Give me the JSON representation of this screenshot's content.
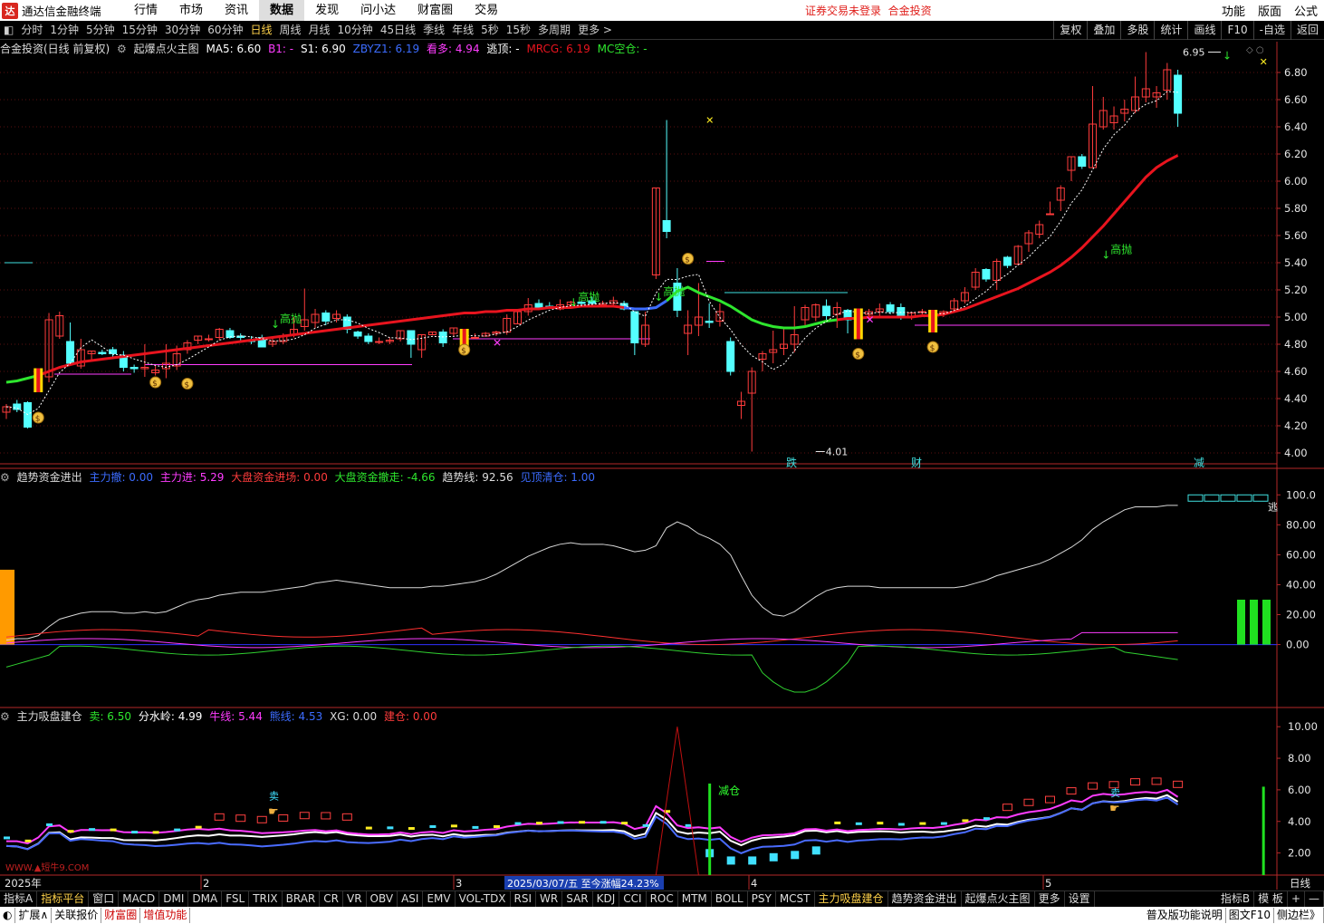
{
  "app": {
    "title": "通达信金融终端",
    "logo_char": "达",
    "login_status": "证券交易未登录",
    "stock_name": "合金投资"
  },
  "menu": [
    "行情",
    "市场",
    "资讯",
    "数据",
    "发现",
    "问小达",
    "财富圈",
    "交易"
  ],
  "right_menu": [
    "功能",
    "版面",
    "公式"
  ],
  "periods": [
    "分时",
    "1分钟",
    "5分钟",
    "15分钟",
    "30分钟",
    "60分钟",
    "日线",
    "周线",
    "月线",
    "10分钟",
    "45日线",
    "季线",
    "年线",
    "5秒",
    "15秒",
    "多周期",
    "更多 >"
  ],
  "active_period": "日线",
  "tools": [
    "复权",
    "叠加",
    "多股",
    "统计",
    "画线",
    "F10",
    "-自选",
    "返回"
  ],
  "main_panel": {
    "title": "合金投资(日线 前复权)",
    "indicator": "起爆点火主图",
    "ma5": "MA5: 6.60",
    "b1": "B1: -",
    "s1": "S1: 6.90",
    "zbyz": "ZBYZ1: 6.19",
    "kanduo": "看多: 4.94",
    "taoding": "逃顶: -",
    "mrcg": "MRCG: 6.19",
    "mckong": "MC空仓: -",
    "y_ticks": [
      "6.80",
      "6.60",
      "6.40",
      "6.20",
      "6.00",
      "5.80",
      "5.60",
      "5.40",
      "5.20",
      "5.00",
      "4.80",
      "4.60",
      "4.40",
      "4.20",
      "4.00"
    ],
    "annotations": {
      "high": "6.95",
      "low": "4.01",
      "gaopao": "高抛",
      "die": "跌",
      "cai": "财",
      "jian": "减"
    }
  },
  "mid_panel": {
    "title": "趋势资金进出",
    "zhuli_che": "主力撤: 0.00",
    "zhuli_jin": "主力进: 5.29",
    "dapan_jin": "大盘资金进场: 0.00",
    "dapan_che": "大盘资金撤走: -4.66",
    "qushi": "趋势线: 92.56",
    "jianding": "见顶清仓: 1.00",
    "y_ticks": [
      "100.0",
      "80.00",
      "60.00",
      "40.00",
      "20.00",
      "0.00"
    ],
    "tao_label": "逃"
  },
  "bot_panel": {
    "title": "主力吸盘建仓",
    "mai": "卖: 6.50",
    "fenshui": "分水岭: 4.99",
    "niuxian": "牛线: 5.44",
    "xiongxian": "熊线: 4.53",
    "xg": "XG: 0.00",
    "jiancang": "建仓: 0.00",
    "y_ticks": [
      "10.00",
      "8.00",
      "6.00",
      "4.00",
      "2.00"
    ],
    "sell_label": "卖",
    "jiancang_label": "减仓",
    "watermark": "WWW.▲短牛9.COM"
  },
  "date_axis": {
    "year": "2025年",
    "months": [
      "2",
      "3",
      "4",
      "5"
    ],
    "tooltip": "2025/03/07/五  至今涨幅24.23%",
    "period_label": "日线"
  },
  "bottom_tabs": [
    "指标A",
    "指标平台",
    "窗口",
    "MACD",
    "DMI",
    "DMA",
    "FSL",
    "TRIX",
    "BRAR",
    "CR",
    "VR",
    "OBV",
    "ASI",
    "EMV",
    "VOL-TDX",
    "RSI",
    "WR",
    "SAR",
    "KDJ",
    "CCI",
    "ROC",
    "MTM",
    "BOLL",
    "PSY",
    "MCST",
    "主力吸盘建仓",
    "趋势资金进出",
    "起爆点火主图",
    "更多",
    "设置"
  ],
  "bottom_tabs_right": [
    "指标B",
    "模 板",
    "+",
    "—"
  ],
  "footer": [
    "扩展∧",
    "关联报价",
    "财富圈",
    "增值功能"
  ],
  "footer_right": [
    "普及版功能说明",
    "图文F10",
    "侧边栏》"
  ],
  "colors": {
    "up": "#ff3c3c",
    "down": "#54ffff",
    "ma_red": "#e8141e",
    "green": "#2ee62e",
    "magenta": "#ff3cff",
    "blue": "#3c6cff",
    "axis": "#b42828"
  },
  "chart_data": {
    "type": "candlestick",
    "candles": [
      [
        4.3,
        4.34,
        4.25,
        4.36
      ],
      [
        4.36,
        4.32,
        4.3,
        4.39
      ],
      [
        4.37,
        4.19,
        4.18,
        4.38
      ],
      [
        4.58,
        4.46,
        4.46,
        4.61
      ],
      [
        4.56,
        4.98,
        4.52,
        5.03
      ],
      [
        4.86,
        5.01,
        4.84,
        5.04
      ],
      [
        4.82,
        4.66,
        4.64,
        4.96
      ],
      [
        4.64,
        4.76,
        4.62,
        4.84
      ],
      [
        4.73,
        4.75,
        4.69,
        4.75
      ],
      [
        4.74,
        4.73,
        4.72,
        4.76
      ],
      [
        4.76,
        4.73,
        4.7,
        4.78
      ],
      [
        4.72,
        4.63,
        4.6,
        4.75
      ],
      [
        4.63,
        4.62,
        4.59,
        4.65
      ],
      [
        4.62,
        4.63,
        4.56,
        4.8
      ],
      [
        4.59,
        4.61,
        4.57,
        4.64
      ],
      [
        4.62,
        4.66,
        4.55,
        4.8
      ],
      [
        4.64,
        4.73,
        4.61,
        4.79
      ],
      [
        4.76,
        4.81,
        4.73,
        4.83
      ],
      [
        4.83,
        4.86,
        4.8,
        4.86
      ],
      [
        4.84,
        4.84,
        4.82,
        4.87
      ],
      [
        4.85,
        4.91,
        4.83,
        4.92
      ],
      [
        4.9,
        4.85,
        4.84,
        4.92
      ],
      [
        4.86,
        4.85,
        4.83,
        4.88
      ],
      [
        4.83,
        4.82,
        4.8,
        4.86
      ],
      [
        4.85,
        4.78,
        4.78,
        4.87
      ],
      [
        4.8,
        4.82,
        4.78,
        4.85
      ],
      [
        4.82,
        4.86,
        4.8,
        4.88
      ],
      [
        4.87,
        4.91,
        4.85,
        5.0
      ],
      [
        4.93,
        4.98,
        4.9,
        5.21
      ],
      [
        4.96,
        5.02,
        4.92,
        5.06
      ],
      [
        5.03,
        4.97,
        4.94,
        5.05
      ],
      [
        4.99,
        5.02,
        4.96,
        5.05
      ],
      [
        5.0,
        4.91,
        4.88,
        5.02
      ],
      [
        4.89,
        4.86,
        4.84,
        4.9
      ],
      [
        4.86,
        4.82,
        4.8,
        4.88
      ],
      [
        4.82,
        4.82,
        4.8,
        4.85
      ],
      [
        4.82,
        4.83,
        4.8,
        4.85
      ],
      [
        4.84,
        4.9,
        4.82,
        4.9
      ],
      [
        4.9,
        4.8,
        4.7,
        4.9
      ],
      [
        4.76,
        4.87,
        4.7,
        4.87
      ],
      [
        4.87,
        4.89,
        4.87,
        4.89
      ],
      [
        4.89,
        4.81,
        4.78,
        4.91
      ],
      [
        4.88,
        4.92,
        4.86,
        4.92
      ],
      [
        4.89,
        4.84,
        4.8,
        4.9
      ],
      [
        4.85,
        4.85,
        4.84,
        4.88
      ],
      [
        4.86,
        4.88,
        4.86,
        4.89
      ],
      [
        4.88,
        4.89,
        4.86,
        4.9
      ],
      [
        4.89,
        4.99,
        4.87,
        5.02
      ],
      [
        4.95,
        5.04,
        4.95,
        5.05
      ],
      [
        5.04,
        5.09,
        5.01,
        5.14
      ],
      [
        5.1,
        5.06,
        5.06,
        5.13
      ],
      [
        5.08,
        5.07,
        5.06,
        5.11
      ],
      [
        5.06,
        5.09,
        5.05,
        5.13
      ],
      [
        5.09,
        5.11,
        5.08,
        5.12
      ],
      [
        5.11,
        5.1,
        5.08,
        5.12
      ],
      [
        5.12,
        5.1,
        5.08,
        5.15
      ],
      [
        5.09,
        5.1,
        5.07,
        5.12
      ],
      [
        5.1,
        5.12,
        5.08,
        5.15
      ],
      [
        5.1,
        5.06,
        5.05,
        5.12
      ],
      [
        5.04,
        4.81,
        4.72,
        5.04
      ],
      [
        4.8,
        4.94,
        4.78,
        5.04
      ],
      [
        5.31,
        5.95,
        5.28,
        5.95
      ],
      [
        5.71,
        5.63,
        5.58,
        6.45
      ],
      [
        5.25,
        5.05,
        5.0,
        5.36
      ],
      [
        4.88,
        4.94,
        4.72,
        5.05
      ],
      [
        4.94,
        5.0,
        4.86,
        5.25
      ],
      [
        4.97,
        4.96,
        4.92,
        5.1
      ],
      [
        4.97,
        5.04,
        4.93,
        5.1
      ],
      [
        4.82,
        4.6,
        4.57,
        4.85
      ],
      [
        4.35,
        4.38,
        4.25,
        4.45
      ],
      [
        4.44,
        4.6,
        4.01,
        4.63
      ],
      [
        4.69,
        4.73,
        4.6,
        4.75
      ],
      [
        4.74,
        4.76,
        4.66,
        4.9
      ],
      [
        4.77,
        4.8,
        4.72,
        4.91
      ],
      [
        4.8,
        4.87,
        4.74,
        5.08
      ],
      [
        4.98,
        5.07,
        4.94,
        5.09
      ],
      [
        5.0,
        5.09,
        4.97,
        5.1
      ],
      [
        5.08,
        5.01,
        4.97,
        5.13
      ],
      [
        5.02,
        5.07,
        4.92,
        5.11
      ],
      [
        5.05,
        4.98,
        4.88,
        5.06
      ],
      [
        4.95,
        5.03,
        4.85,
        5.05
      ],
      [
        5.02,
        5.04,
        4.97,
        5.06
      ],
      [
        5.04,
        5.06,
        4.99,
        5.1
      ],
      [
        5.09,
        5.04,
        5.02,
        5.11
      ],
      [
        5.07,
        5.0,
        4.98,
        5.1
      ],
      [
        5.0,
        5.03,
        4.98,
        5.04
      ],
      [
        5.04,
        5.04,
        5.0,
        5.06
      ],
      [
        5.01,
        5.01,
        4.9,
        5.04
      ],
      [
        5.03,
        5.04,
        5.0,
        5.05
      ],
      [
        5.06,
        5.12,
        5.04,
        5.14
      ],
      [
        5.12,
        5.18,
        5.1,
        5.22
      ],
      [
        5.22,
        5.33,
        5.2,
        5.36
      ],
      [
        5.35,
        5.28,
        5.26,
        5.36
      ],
      [
        5.27,
        5.41,
        5.2,
        5.43
      ],
      [
        5.44,
        5.38,
        5.36,
        5.45
      ],
      [
        5.39,
        5.52,
        5.38,
        5.53
      ],
      [
        5.54,
        5.62,
        5.48,
        5.64
      ],
      [
        5.61,
        5.68,
        5.58,
        5.71
      ],
      [
        5.76,
        5.76,
        5.76,
        5.85
      ],
      [
        5.86,
        5.95,
        5.78,
        5.97
      ],
      [
        6.08,
        6.18,
        6.0,
        6.18
      ],
      [
        6.18,
        6.11,
        6.09,
        6.2
      ],
      [
        6.1,
        6.42,
        6.1,
        6.7
      ],
      [
        6.4,
        6.52,
        6.38,
        6.62
      ],
      [
        6.43,
        6.48,
        6.38,
        6.55
      ],
      [
        6.5,
        6.53,
        6.44,
        6.6
      ],
      [
        6.52,
        6.62,
        6.5,
        6.77
      ],
      [
        6.62,
        6.68,
        6.58,
        6.95
      ],
      [
        6.62,
        6.65,
        6.54,
        6.7
      ],
      [
        6.67,
        6.82,
        6.6,
        6.87
      ],
      [
        6.78,
        6.5,
        6.4,
        6.82
      ]
    ],
    "trend_line": [
      0.03,
      0.04,
      0.04,
      0.06,
      0.12,
      0.17,
      0.19,
      0.21,
      0.22,
      0.22,
      0.22,
      0.21,
      0.21,
      0.22,
      0.21,
      0.22,
      0.25,
      0.28,
      0.3,
      0.31,
      0.33,
      0.34,
      0.35,
      0.35,
      0.35,
      0.36,
      0.37,
      0.38,
      0.39,
      0.41,
      0.42,
      0.43,
      0.42,
      0.41,
      0.4,
      0.39,
      0.38,
      0.38,
      0.38,
      0.38,
      0.39,
      0.39,
      0.4,
      0.41,
      0.42,
      0.44,
      0.47,
      0.51,
      0.55,
      0.59,
      0.62,
      0.65,
      0.67,
      0.68,
      0.67,
      0.67,
      0.67,
      0.66,
      0.64,
      0.62,
      0.63,
      0.66,
      0.78,
      0.82,
      0.79,
      0.74,
      0.71,
      0.67,
      0.6,
      0.46,
      0.33,
      0.25,
      0.2,
      0.19,
      0.22,
      0.27,
      0.32,
      0.36,
      0.38,
      0.39,
      0.39,
      0.39,
      0.38,
      0.38,
      0.38,
      0.38,
      0.38,
      0.38,
      0.38,
      0.38,
      0.39,
      0.41,
      0.43,
      0.46,
      0.48,
      0.5,
      0.52,
      0.54,
      0.57,
      0.61,
      0.65,
      0.7,
      0.77,
      0.82,
      0.86,
      0.9,
      0.92,
      0.92,
      0.92,
      0.93,
      0.93
    ],
    "y_range_main": [
      3.92,
      6.92
    ],
    "y_range_mid": [
      -0.42,
      1.05
    ],
    "y_range_bot": [
      0.6,
      10.7
    ]
  }
}
